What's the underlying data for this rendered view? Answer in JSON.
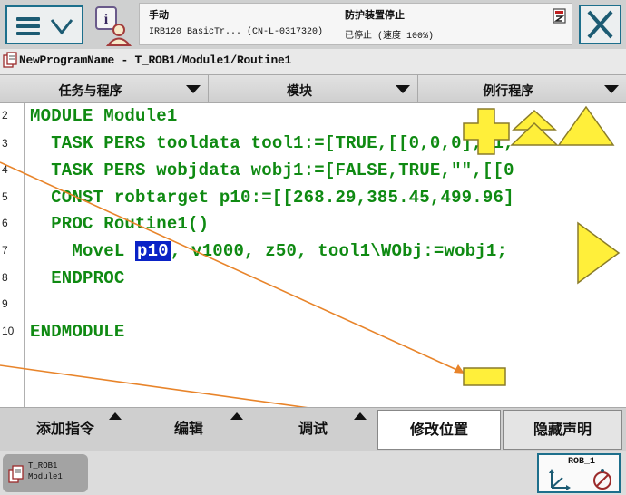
{
  "status": {
    "mode": "手动",
    "system": "IRB120_BasicTr... (CN-L-0317320)",
    "guard": "防护装置停止",
    "state": "已停止 (速度 100%)"
  },
  "path": "NewProgramName - T_ROB1/Module1/Routine1",
  "tabs": [
    "任务与程序",
    "模块",
    "例行程序"
  ],
  "code": {
    "line_numbers": [
      "2",
      "3",
      "4",
      "5",
      "6",
      "7",
      "8",
      "9",
      "10"
    ],
    "lines": [
      "MODULE Module1",
      "  TASK PERS tooldata tool1:=[TRUE,[[0,0,0],[1,",
      "  TASK PERS wobjdata wobj1:=[FALSE,TRUE,\"\",[[0",
      "  CONST robtarget p10:=[[268.29,385.45,499.96]",
      "  PROC Routine1()",
      "    MoveL ",
      "  ENDPROC",
      "",
      "ENDMODULE"
    ],
    "selected_token": "p10",
    "movel_rest": ", v1000, z50, tool1\\WObj:=wobj1;"
  },
  "commands": {
    "add": "添加指令",
    "edit": "编辑",
    "debug": "调试",
    "modify": "修改位置",
    "hide": "隐藏声明"
  },
  "taskbar": {
    "item": "T_ROB1\nModule1",
    "rob": "ROB_1"
  },
  "colors": {
    "code_green": "#0f8a12",
    "selection_blue": "#0a22c6",
    "accent_teal": "#1d6f8c",
    "overlay_yellow": "#ffef3a",
    "overlay_orange": "#e8842a"
  },
  "icons": {
    "menu": "hamburger-chevron-icon",
    "info": "info-person-icon",
    "close": "close-x-icon",
    "path": "program-file-icon",
    "zoom_in": "plus-icon",
    "zoom_out": "minus-icon",
    "scroll_up": "double-up-arrow-icon",
    "page_up": "up-triangle-icon",
    "scroll_right": "right-triangle-icon"
  }
}
